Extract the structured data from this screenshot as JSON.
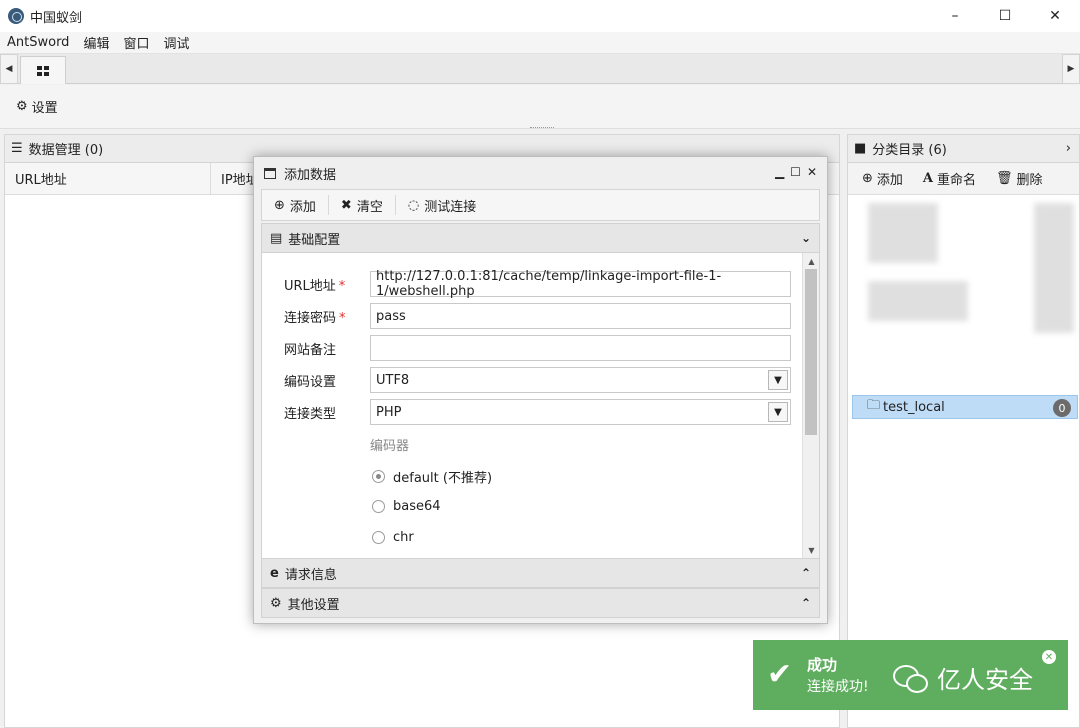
{
  "window": {
    "title": "中国蚁剑",
    "minimize": "–",
    "maximize": "☐",
    "close": "✕"
  },
  "menu": [
    "AntSword",
    "编辑",
    "窗口",
    "调试"
  ],
  "tabs": {
    "scroll_left": "◀",
    "scroll_right": "▶"
  },
  "toolbar": {
    "settings_label": "设置"
  },
  "data_panel": {
    "title": "数据管理 (0)",
    "columns": [
      "URL地址",
      "IP地址"
    ]
  },
  "category_panel": {
    "title": "分类目录 (6)",
    "add_label": "添加",
    "rename_label": "重命名",
    "delete_label": "删除",
    "selected_item": "test_local",
    "selected_count": "0"
  },
  "dialog": {
    "title": "添加数据",
    "toolbar": {
      "add_label": "添加",
      "clear_label": "清空",
      "test_label": "测试连接"
    },
    "sections": {
      "basic": "基础配置",
      "request": "请求信息",
      "other": "其他设置"
    },
    "form": {
      "url_label": "URL地址",
      "url_value": "http://127.0.0.1:81/cache/temp/linkage-import-file-1-1/webshell.php",
      "password_label": "连接密码",
      "password_value": "pass",
      "note_label": "网站备注",
      "note_value": "",
      "encoding_label": "编码设置",
      "encoding_value": "UTF8",
      "type_label": "连接类型",
      "type_value": "PHP",
      "encoder_title": "编码器",
      "encoders": [
        "default (不推荐)",
        "base64",
        "chr"
      ],
      "selected_encoder": "default (不推荐)",
      "required_mark": "*"
    }
  },
  "toast": {
    "title": "成功",
    "message": "连接成功!",
    "close": "✕"
  },
  "watermark": {
    "text": "亿人安全"
  }
}
